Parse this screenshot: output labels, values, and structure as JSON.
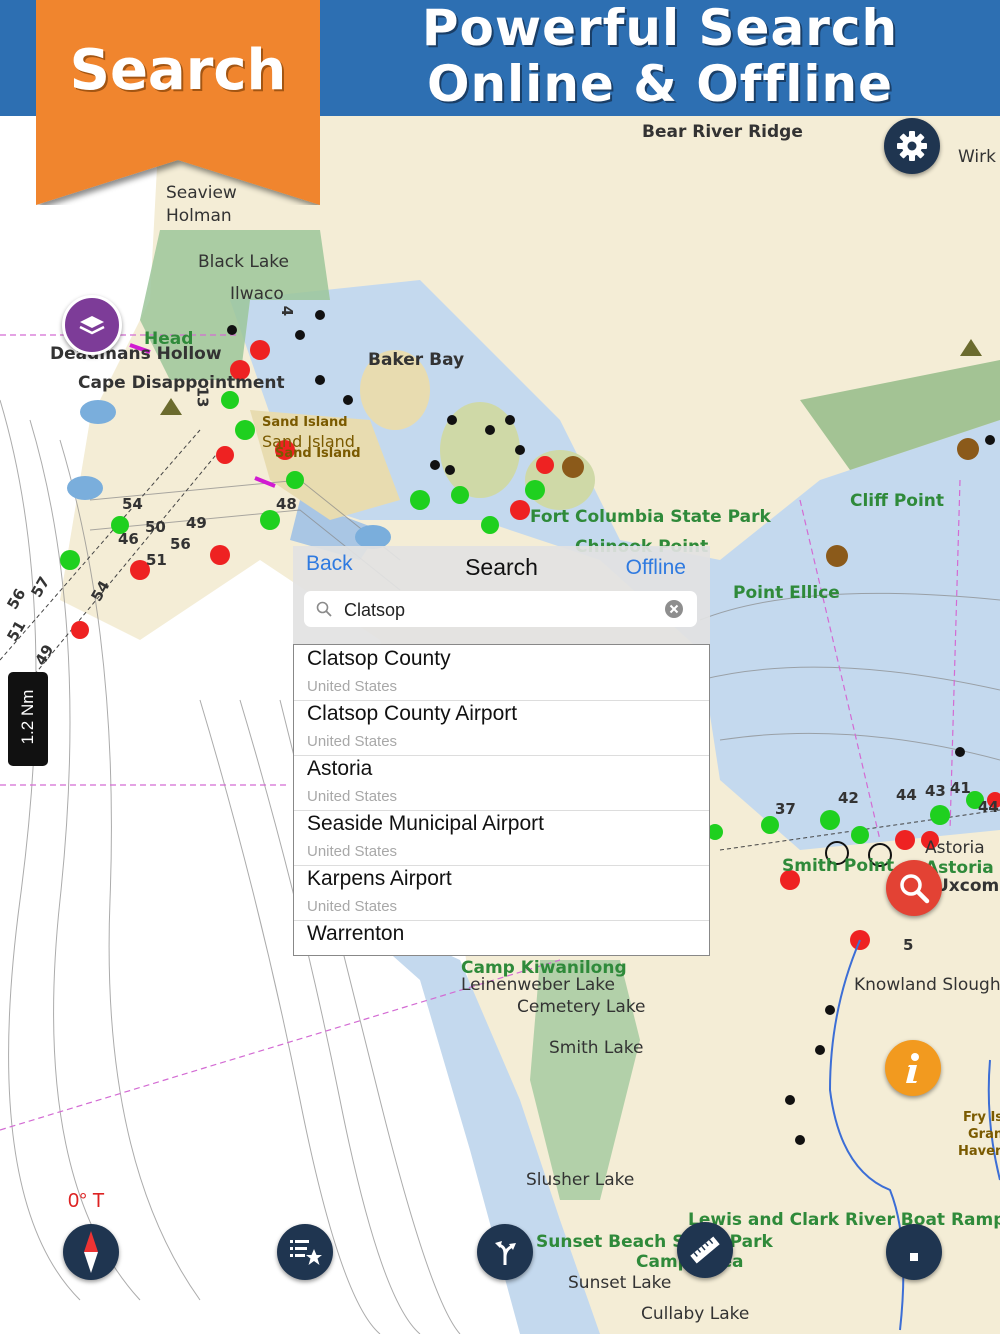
{
  "banner": {
    "badge_label": "Search",
    "title_line1": "Powerful Search",
    "title_line2": "Online & Offline"
  },
  "map": {
    "labels": {
      "bear_river_ridge": "Bear River Ridge",
      "wirk": "Wirk",
      "seaview": "Seaview",
      "holman": "Holman",
      "black_lake": "Black Lake",
      "ilwaco": "Ilwaco",
      "head": "Head",
      "deadmans_hollow": "Deadmans Hollow",
      "cape_disappointment": "Cape Disappointment",
      "baker_bay": "Baker Bay",
      "sand_island_1": "Sand Island",
      "sand_island_2": "Sand Island",
      "sand_island_3": "Sand Island",
      "fort_columbia": "Fort Columbia State Park",
      "chinook_point": "Chinook Point",
      "cliff_point": "Cliff Point",
      "point_ellice": "Point Ellice",
      "smith_point": "Smith Point",
      "astoria": "Astoria",
      "astoria_co": "Astoria Co",
      "uxcomb": "Uxcomb",
      "camp_kiwanilong": "Camp Kiwanilong",
      "leinenweber_lake": "Leinenweber Lake",
      "cemetery_lake": "Cemetery Lake",
      "smith_lake": "Smith Lake",
      "knowland_slough": "Knowland Slough",
      "slusher_lake": "Slusher Lake",
      "beach_state_park": "Sunset Beach State Park",
      "camp_clatsop": "Camp Rilea",
      "sunset_lake": "Sunset Lake",
      "cullaby_lake": "Cullaby Lake",
      "lewis_clark": "Lewis and Clark River Boat Ramp",
      "fry": "Fry Is",
      "gran": "Gran",
      "haven": "Haven"
    },
    "depths": [
      "54",
      "50",
      "49",
      "46",
      "56",
      "51",
      "56",
      "57",
      "54",
      "51",
      "49",
      "48",
      "37",
      "42",
      "44",
      "43",
      "41",
      "44",
      "5",
      "13",
      "4"
    ]
  },
  "scale_label": "1.2 Nm",
  "compass_label": "0° T",
  "search_panel": {
    "back_label": "Back",
    "title": "Search",
    "offline_label": "Offline",
    "query": "Clatsop",
    "placeholder": "Search",
    "results": [
      {
        "name": "Clatsop County",
        "country": "United States"
      },
      {
        "name": "Clatsop County Airport",
        "country": "United States"
      },
      {
        "name": "Astoria",
        "country": "United States"
      },
      {
        "name": "Seaside Municipal Airport",
        "country": "United States"
      },
      {
        "name": "Karpens Airport",
        "country": "United States"
      },
      {
        "name": "Warrenton",
        "country": ""
      }
    ]
  },
  "colors": {
    "banner_blue": "#2d6fb2",
    "badge_orange": "#f0852d",
    "water": "#c4d9ee",
    "land": "#f4edd6",
    "park_green": "#9cc59a",
    "accent_link": "#2f7ae0"
  },
  "icons": [
    "layers-icon",
    "settings-gear-icon",
    "search-icon",
    "info-icon",
    "compass-icon",
    "favorites-list-icon",
    "route-icon",
    "ruler-icon",
    "stop-icon",
    "clear-icon"
  ]
}
